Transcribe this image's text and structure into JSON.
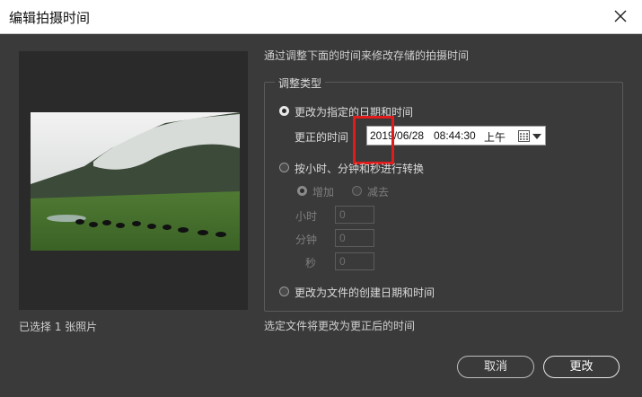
{
  "window": {
    "title": "编辑拍摄时间"
  },
  "instruction": "通过调整下面的时间来修改存储的拍摄时间",
  "adjust_group": {
    "legend": "调整类型",
    "option_specified": {
      "label": "更改为指定的日期和时间",
      "corrected_time_label": "更正的时间",
      "date": "2019/06/28",
      "time": "08:44:30",
      "ampm": "上午"
    },
    "option_shift": {
      "label": "按小时、分钟和秒进行转换",
      "add_label": "增加",
      "subtract_label": "减去",
      "hours_label": "小时",
      "hours_value": "0",
      "minutes_label": "分钟",
      "minutes_value": "0",
      "seconds_label": "秒",
      "seconds_value": "0"
    },
    "option_file_created": {
      "label": "更改为文件的创建日期和时间"
    }
  },
  "selected_count": "已选择 1 张照片",
  "footer_note": "选定文件将更改为更正后的时间",
  "buttons": {
    "cancel": "取消",
    "change": "更改"
  },
  "colors": {
    "highlight": "#e01b1b",
    "background": "#3a3a3a"
  }
}
